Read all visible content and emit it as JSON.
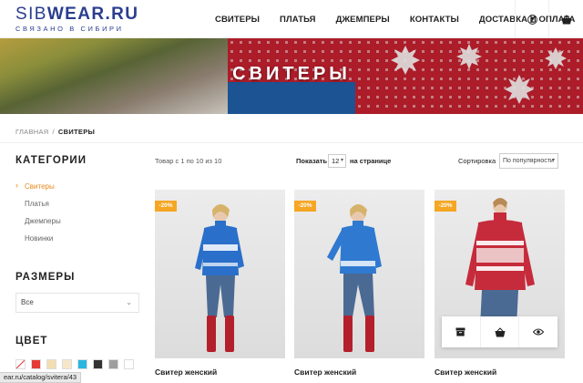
{
  "header": {
    "logo_bold": "SIB",
    "logo_rest": "WEAR.RU",
    "tagline": "СВЯЗАНО В СИБИРИ",
    "nav": [
      "СВИТЕРЫ",
      "ПЛАТЬЯ",
      "ДЖЕМПЕРЫ",
      "КОНТАКТЫ",
      "ДОСТАВКА И ОПЛАТА"
    ],
    "icons": [
      "user-icon",
      "basket-icon"
    ]
  },
  "banner": {
    "title": "СВИТЕРЫ"
  },
  "breadcrumb": {
    "home": "ГЛАВНАЯ",
    "separator": "/",
    "current": "СВИТЕРЫ"
  },
  "sidebar": {
    "categories_title": "КАТЕГОРИИ",
    "categories": [
      {
        "label": "Свитеры",
        "active": true
      },
      {
        "label": "Платья",
        "active": false
      },
      {
        "label": "Джемперы",
        "active": false
      },
      {
        "label": "Новинки",
        "active": false
      }
    ],
    "sizes_title": "РАЗМЕРЫ",
    "sizes_value": "Все",
    "color_title": "ЦВЕТ",
    "colors": [
      "#ffffff",
      "#e53935",
      "#f3deb2",
      "#f7e7c8",
      "#29b6e0",
      "#333333",
      "#9e9e9e",
      "#ffffff"
    ]
  },
  "toolbar": {
    "results": "Товар с 1 по 10 из 10",
    "show_label": "Показать",
    "per_page_value": "12",
    "per_page_suffix": "на странице",
    "sort_label": "Сортировка",
    "sort_value": "По популярности"
  },
  "products": [
    {
      "badge": "-20%",
      "name": "Свитер женский",
      "sweater_color": "#2a6fc9"
    },
    {
      "badge": "-20%",
      "name": "Свитер женский",
      "sweater_color": "#2f79d1"
    },
    {
      "badge": "-20%",
      "name": "Свитер женский",
      "sweater_color": "#c62b3b"
    }
  ],
  "quick_actions": [
    "archive-icon",
    "basket-icon",
    "eye-icon"
  ],
  "status_url": "ear.ru/catalog/svitera/43",
  "colors": {
    "accent": "#f5a623",
    "brand": "#2a3d8f",
    "active_link": "#e58a1f"
  }
}
